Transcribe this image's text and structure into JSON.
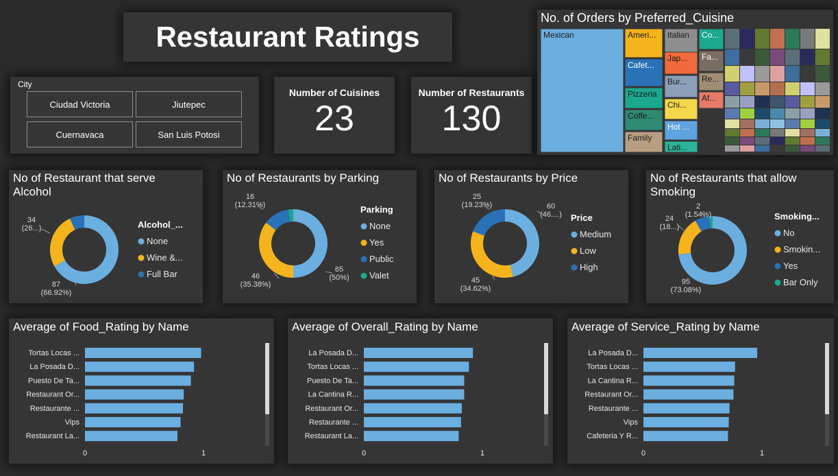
{
  "header": {
    "title": "Restaurant Ratings"
  },
  "city_filter": {
    "label": "City",
    "options": [
      "Ciudad Victoria",
      "Jiutepec",
      "Cuernavaca",
      "San Luis Potosi"
    ]
  },
  "kpis": {
    "cuisines": {
      "label": "Number of Cuisines",
      "value": "23"
    },
    "restaurants": {
      "label": "Number of Restaurants",
      "value": "130"
    }
  },
  "colors": {
    "accent_blue": "#6baee0",
    "yellow": "#f5b41c",
    "dark_blue": "#2a72b8",
    "teal": "#1aa88e",
    "background": "#2b2b2b",
    "card": "#353535"
  },
  "chart_data": [
    {
      "id": "treemap",
      "type": "treemap",
      "title": "No. of Orders by Preferred_Cuisine",
      "labeled_tiles": [
        "Mexican",
        "Ameri...",
        "Italian",
        "Co...",
        "Cafet...",
        "Jap...",
        "Fa...",
        "Pizzeria",
        "Bur...",
        "Re...",
        "Coffe...",
        "Chi...",
        "Af...",
        "Family",
        "Hot ...",
        "Lati..."
      ]
    },
    {
      "id": "alcohol",
      "type": "pie",
      "title": "No of Restaurant that serve Alcohol",
      "legend_title": "Alcohol_...",
      "labels": [
        "None",
        "Wine &...",
        "Full Bar"
      ],
      "values": [
        87,
        34,
        9
      ],
      "colors": [
        "#6baee0",
        "#f5b41c",
        "#2a72b8"
      ],
      "data_labels": [
        {
          "value": "87",
          "pct": "(66.92%)"
        },
        {
          "value": "34",
          "pct": "(26...)"
        }
      ]
    },
    {
      "id": "parking",
      "type": "pie",
      "title": "No of Restaurants by Parking",
      "legend_title": "Parking",
      "labels": [
        "None",
        "Yes",
        "Public",
        "Valet"
      ],
      "values": [
        65,
        46,
        16,
        3
      ],
      "colors": [
        "#6baee0",
        "#f5b41c",
        "#2a72b8",
        "#1aa88e"
      ],
      "data_labels": [
        {
          "value": "65",
          "pct": "(50%)"
        },
        {
          "value": "46",
          "pct": "(35.38%)"
        },
        {
          "value": "16",
          "pct": "(12.31%)"
        }
      ]
    },
    {
      "id": "price",
      "type": "pie",
      "title": "No of Restaurants by Price",
      "legend_title": "Price",
      "labels": [
        "Medium",
        "Low",
        "High"
      ],
      "values": [
        60,
        45,
        25
      ],
      "colors": [
        "#6baee0",
        "#f5b41c",
        "#2a72b8"
      ],
      "data_labels": [
        {
          "value": "60",
          "pct": "(46....)"
        },
        {
          "value": "45",
          "pct": "(34.62%)"
        },
        {
          "value": "25",
          "pct": "(19.23%)"
        }
      ]
    },
    {
      "id": "smoking",
      "type": "pie",
      "title": "No of Restaurants that allow Smoking",
      "legend_title": "Smoking...",
      "labels": [
        "No",
        "Smokin...",
        "Yes",
        "Bar Only"
      ],
      "values": [
        95,
        24,
        9,
        2
      ],
      "colors": [
        "#6baee0",
        "#f5b41c",
        "#2a72b8",
        "#1aa88e"
      ],
      "data_labels": [
        {
          "value": "95",
          "pct": "(73.08%)"
        },
        {
          "value": "24",
          "pct": "(18...)"
        },
        {
          "value": "2",
          "pct": "(1.54%)"
        }
      ]
    },
    {
      "id": "food",
      "type": "bar",
      "orientation": "horizontal",
      "title": "Average of Food_Rating by Name",
      "categories": [
        "Tortas Locas ...",
        "La Posada D...",
        "Puesto De Ta...",
        "Restaurant Or...",
        "Restaurante ...",
        "Vips",
        "Restaurant La..."
      ],
      "values": [
        1.47,
        1.38,
        1.34,
        1.25,
        1.24,
        1.21,
        1.17
      ],
      "xlim": [
        0,
        1.5
      ],
      "ticks": [
        "0",
        "1"
      ],
      "color": "#6baee0"
    },
    {
      "id": "overall",
      "type": "bar",
      "orientation": "horizontal",
      "title": "Average of Overall_Rating by Name",
      "categories": [
        "La Posada D...",
        "Tortas Locas ...",
        "Puesto De Ta...",
        "La Cantina R...",
        "Restaurant Or...",
        "Restaurante ...",
        "Restaurant La..."
      ],
      "values": [
        1.38,
        1.33,
        1.27,
        1.27,
        1.24,
        1.23,
        1.2
      ],
      "xlim": [
        0,
        1.5
      ],
      "ticks": [
        "0",
        "1"
      ],
      "color": "#6baee0"
    },
    {
      "id": "service",
      "type": "bar",
      "orientation": "horizontal",
      "title": "Average of Service_Rating by Name",
      "categories": [
        "La Posada D...",
        "Tortas Locas ...",
        "La Cantina R...",
        "Restaurant Or...",
        "Restaurante ...",
        "Vips",
        "Cafeteria Y R..."
      ],
      "values": [
        1.44,
        1.16,
        1.15,
        1.14,
        1.09,
        1.08,
        1.07
      ],
      "xlim": [
        0,
        1.5
      ],
      "ticks": [
        "0",
        "1"
      ],
      "color": "#6baee0"
    }
  ]
}
